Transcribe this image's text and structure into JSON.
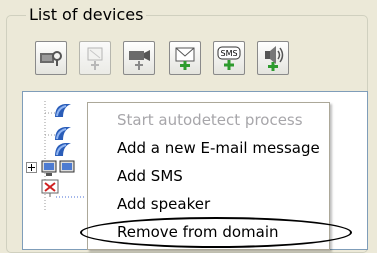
{
  "window": {
    "group_title": "List of devices"
  },
  "toolbar": {
    "buttons": [
      {
        "icon": "camera-search-icon",
        "enabled": true
      },
      {
        "icon": "add-generic-device-icon",
        "enabled": false
      },
      {
        "icon": "add-camera-icon",
        "enabled": true
      },
      {
        "icon": "add-email-icon",
        "enabled": true
      },
      {
        "icon": "add-sms-icon",
        "enabled": true
      },
      {
        "icon": "add-speaker-icon",
        "enabled": true
      }
    ]
  },
  "context_menu": {
    "items": [
      {
        "label": "Start autodetect process",
        "enabled": false
      },
      {
        "label": "Add a new E-mail message",
        "enabled": true
      },
      {
        "label": "Add SMS",
        "enabled": true
      },
      {
        "label": "Add speaker",
        "enabled": true
      },
      {
        "label": "Remove from domain",
        "enabled": true,
        "highlighted": true
      }
    ]
  },
  "colors": {
    "menu_disabled": "#a7a6aa",
    "plus_green": "#2e9b2e",
    "accent_blue": "#2a5db8"
  }
}
